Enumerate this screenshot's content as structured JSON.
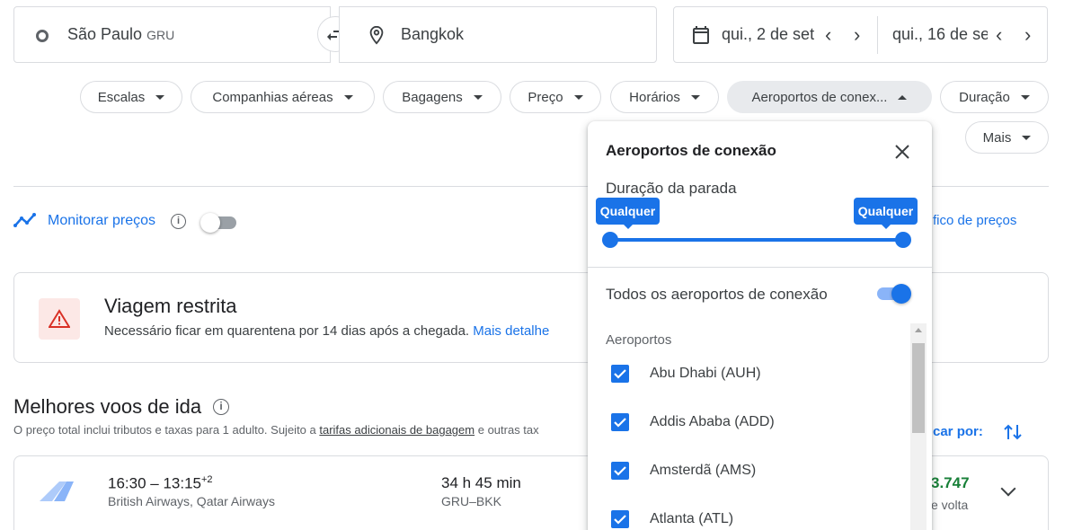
{
  "search": {
    "origin_city": "São Paulo",
    "origin_code": "GRU",
    "destination": "Bangkok",
    "depart_date": "qui., 2 de set",
    "return_date": "qui., 16 de se"
  },
  "filters": [
    {
      "label": "Escalas"
    },
    {
      "label": "Companhias aéreas"
    },
    {
      "label": "Bagagens"
    },
    {
      "label": "Preço"
    },
    {
      "label": "Horários"
    },
    {
      "label": "Aeroportos de conex..."
    },
    {
      "label": "Duração"
    },
    {
      "label": "Mais"
    }
  ],
  "tracking": {
    "label": "Monitorar preços",
    "toggle_on": false,
    "price_graph_label": "fico de preços"
  },
  "restricted": {
    "title": "Viagem restrita",
    "text": "Necessário ficar em quarentena por 14 dias após a chegada.",
    "link": "Mais detalhe"
  },
  "best_flights": {
    "title": "Melhores voos de ida",
    "note_before": "O preço total inclui tributos e taxas para 1 adulto. Sujeito a ",
    "note_link": "tarifas adicionais de bagagem",
    "note_after": " e outras tax",
    "sort_label": "car por:"
  },
  "flight": {
    "times": "16:30 – 13:15",
    "day_offset": "+2",
    "airlines": "British Airways, Qatar Airways",
    "duration": "34 h 45 min",
    "route": "GRU–BKK",
    "price": "3.747",
    "price_note": "e volta"
  },
  "popup": {
    "title": "Aeroportos de conexão",
    "stop_duration_label": "Duração da parada",
    "slider_min_label": "Qualquer",
    "slider_max_label": "Qualquer",
    "all_airports_label": "Todos os aeroportos de conexão",
    "all_airports_on": true,
    "airports_heading": "Aeroportos",
    "airports": [
      {
        "name": "Abu Dhabi (AUH)",
        "checked": true
      },
      {
        "name": "Addis Ababa (ADD)",
        "checked": true
      },
      {
        "name": "Amsterdã (AMS)",
        "checked": true
      },
      {
        "name": "Atlanta (ATL)",
        "checked": true
      }
    ]
  },
  "colors": {
    "accent": "#1a73e8",
    "price_green": "#188038",
    "warning_red": "#d93025"
  }
}
